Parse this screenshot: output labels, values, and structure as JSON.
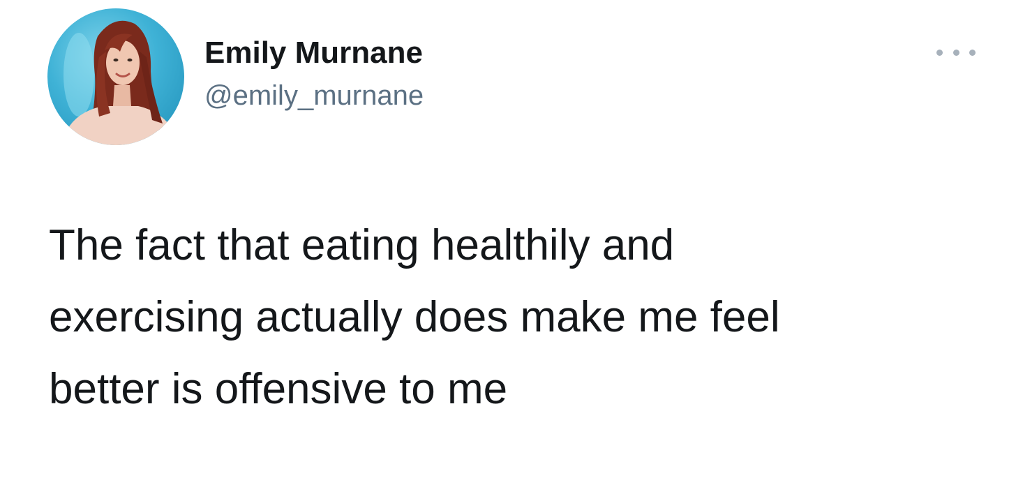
{
  "tweet": {
    "author": {
      "display_name": "Emily Murnane",
      "handle": "@emily_murnane",
      "avatar_icon": "profile-photo"
    },
    "more_icon": "ellipsis-icon",
    "text": "The fact that eating healthily and\nexercising actually does make me feel\nbetter is offensive to me"
  },
  "colors": {
    "background": "#ffffff",
    "text": "#14171a",
    "secondary_text": "#5b7083",
    "avatar_background": "#3fb2d6"
  }
}
